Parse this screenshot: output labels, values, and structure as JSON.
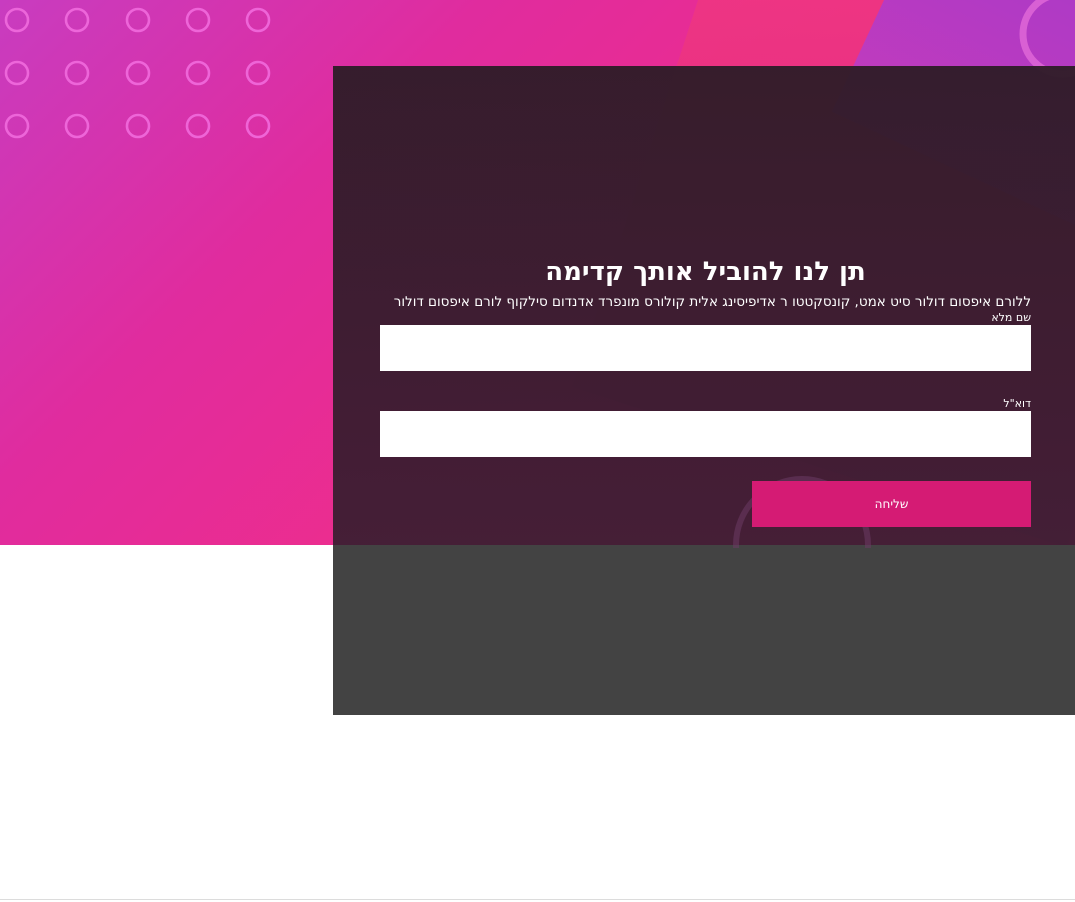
{
  "hero": {
    "title": "תן לנו להוביל אותך קדימה",
    "subtitle": "ללורם איפסום דולור סיט אמט, קונסקטטו ר אדיפיסינג אלית קולורס מונפרד אדנדום סילקוף לורם איפסום דולור"
  },
  "form": {
    "name_label": "שם מלא",
    "name_value": "",
    "email_label": "דוא\"ל",
    "email_value": "",
    "submit_label": "שליחה"
  },
  "colors": {
    "accent": "#d51b74",
    "overlay": "#3a1c30",
    "overlay_bottom": "#434343",
    "gradient_start": "#c83cc0",
    "gradient_end": "#ee2d8c"
  },
  "icons": {
    "decor_dots": "circle-outline-grid",
    "decor_ring": "ring-outline"
  }
}
